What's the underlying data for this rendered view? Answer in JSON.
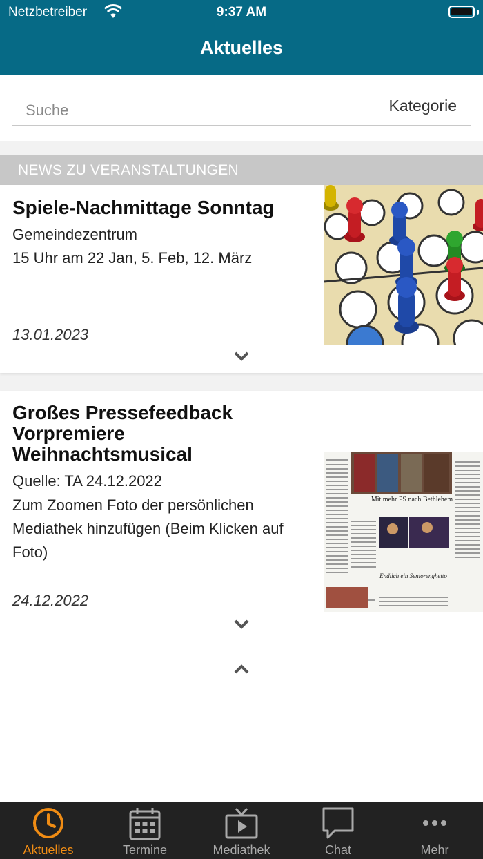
{
  "status": {
    "carrier": "Netzbetreiber",
    "time": "9:37 AM"
  },
  "header": {
    "title": "Aktuelles"
  },
  "search": {
    "placeholder": "Suche",
    "category": "Kategorie"
  },
  "section": {
    "title": "NEWS ZU VERANSTALTUNGEN"
  },
  "news": [
    {
      "title": "Spiele-Nachmittage Sonntag",
      "lines": [
        "Gemeindezentrum",
        "15 Uhr am 22 Jan, 5. Feb, 12. März"
      ],
      "date": "13.01.2023",
      "image": "board-game-pawns"
    },
    {
      "title_lines": [
        "Großes Pressefeedback",
        "Vorpremiere",
        "Weihnachtsmusical"
      ],
      "lines": [
        "Quelle: TA 24.12.2022",
        "Zum Zoomen Foto der persönlichen",
        "Mediathek hinzufügen (Beim Klicken auf",
        "Foto)"
      ],
      "date": "24.12.2022",
      "image": "newspaper-clipping",
      "clipping": {
        "headline": "Mit mehr PS nach Bethlehem",
        "subheadline": "Endlich ein Seniorenghetto"
      }
    }
  ],
  "tabs": [
    {
      "label": "Aktuelles",
      "icon": "clock-icon",
      "active": true
    },
    {
      "label": "Termine",
      "icon": "calendar-icon",
      "active": false
    },
    {
      "label": "Mediathek",
      "icon": "tv-play-icon",
      "active": false
    },
    {
      "label": "Chat",
      "icon": "chat-bubble-icon",
      "active": false
    },
    {
      "label": "Mehr",
      "icon": "more-dots-icon",
      "active": false
    }
  ],
  "colors": {
    "header": "#066a86",
    "accent": "#f08c14",
    "tabbar": "#222222",
    "section": "#c7c7c7"
  }
}
